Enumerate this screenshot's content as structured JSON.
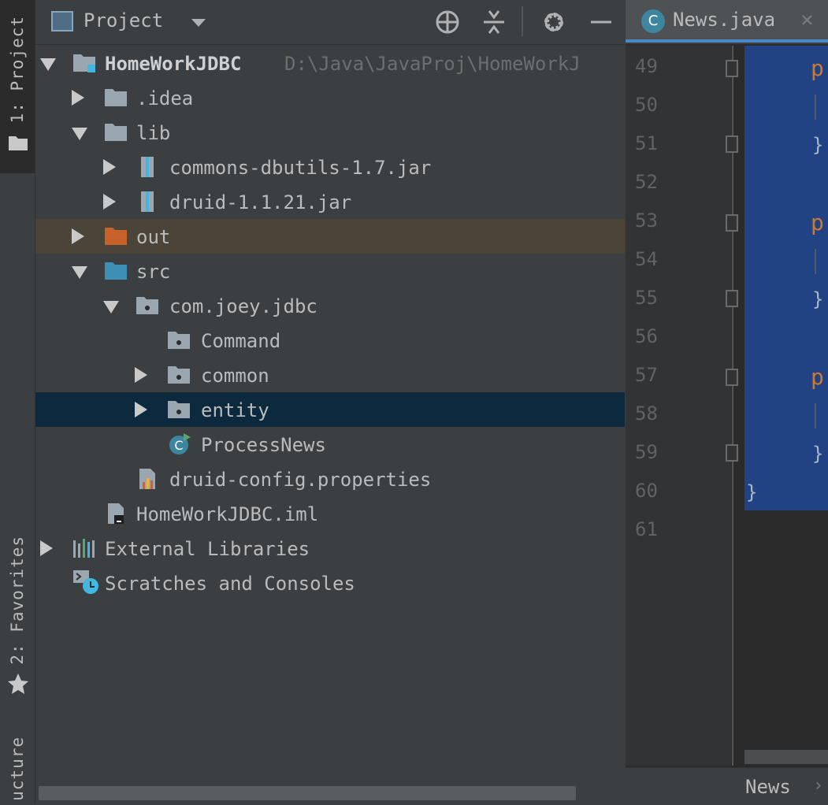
{
  "tool_strip": {
    "project_tab": "1: Project",
    "favorites_tab": "2: Favorites",
    "structure_tab": "ucture"
  },
  "project_panel": {
    "view_selector": "Project",
    "header_icons": [
      "locate-icon",
      "collapse-all-icon",
      "gear-icon",
      "minimize-icon"
    ]
  },
  "tree": [
    {
      "label": "HomeWorkJDBC",
      "path": "D:\\Java\\JavaProj\\HomeWorkJ",
      "icon": "module-folder-icon",
      "expanded": true
    },
    {
      "label": ".idea",
      "icon": "folder-icon",
      "expanded": false
    },
    {
      "label": "lib",
      "icon": "folder-icon",
      "expanded": true
    },
    {
      "label": "commons-dbutils-1.7.jar",
      "icon": "jar-icon",
      "expanded": false
    },
    {
      "label": "druid-1.1.21.jar",
      "icon": "jar-icon",
      "expanded": false
    },
    {
      "label": "out",
      "icon": "excluded-folder-icon",
      "expanded": false
    },
    {
      "label": "src",
      "icon": "source-folder-icon",
      "expanded": true
    },
    {
      "label": "com.joey.jdbc",
      "icon": "package-icon",
      "expanded": true
    },
    {
      "label": "Command",
      "icon": "package-icon"
    },
    {
      "label": "common",
      "icon": "package-icon",
      "expanded": false
    },
    {
      "label": "entity",
      "icon": "package-icon",
      "expanded": false,
      "selected": true
    },
    {
      "label": "ProcessNews",
      "icon": "java-class-runnable-icon"
    },
    {
      "label": "druid-config.properties",
      "icon": "properties-file-icon"
    },
    {
      "label": "HomeWorkJDBC.iml",
      "icon": "iml-file-icon"
    },
    {
      "label": "External Libraries",
      "icon": "libraries-icon",
      "expanded": false
    },
    {
      "label": "Scratches and Consoles",
      "icon": "scratches-icon"
    }
  ],
  "editor": {
    "tab_icon_letter": "C",
    "tab_label": "News.java",
    "close_glyph": "×",
    "line_numbers": [
      "49",
      "50",
      "51",
      "52",
      "53",
      "54",
      "55",
      "56",
      "57",
      "58",
      "59",
      "60",
      "61"
    ],
    "code_fragments": {
      "kw1": "p",
      "kw2": "p",
      "kw3": "p",
      "brace1": "}",
      "brace2": "}",
      "brace3": "}",
      "brace_close": "}"
    },
    "breadcrumb": "News",
    "breadcrumb_arrow": "›"
  },
  "colors": {
    "panel_bg": "#3c3f41",
    "editor_bg": "#2b2b2b",
    "selection_row": "#0d293e",
    "excluded_row": "#4a4538",
    "editor_selection": "#214283",
    "keyword": "#cc7832"
  }
}
